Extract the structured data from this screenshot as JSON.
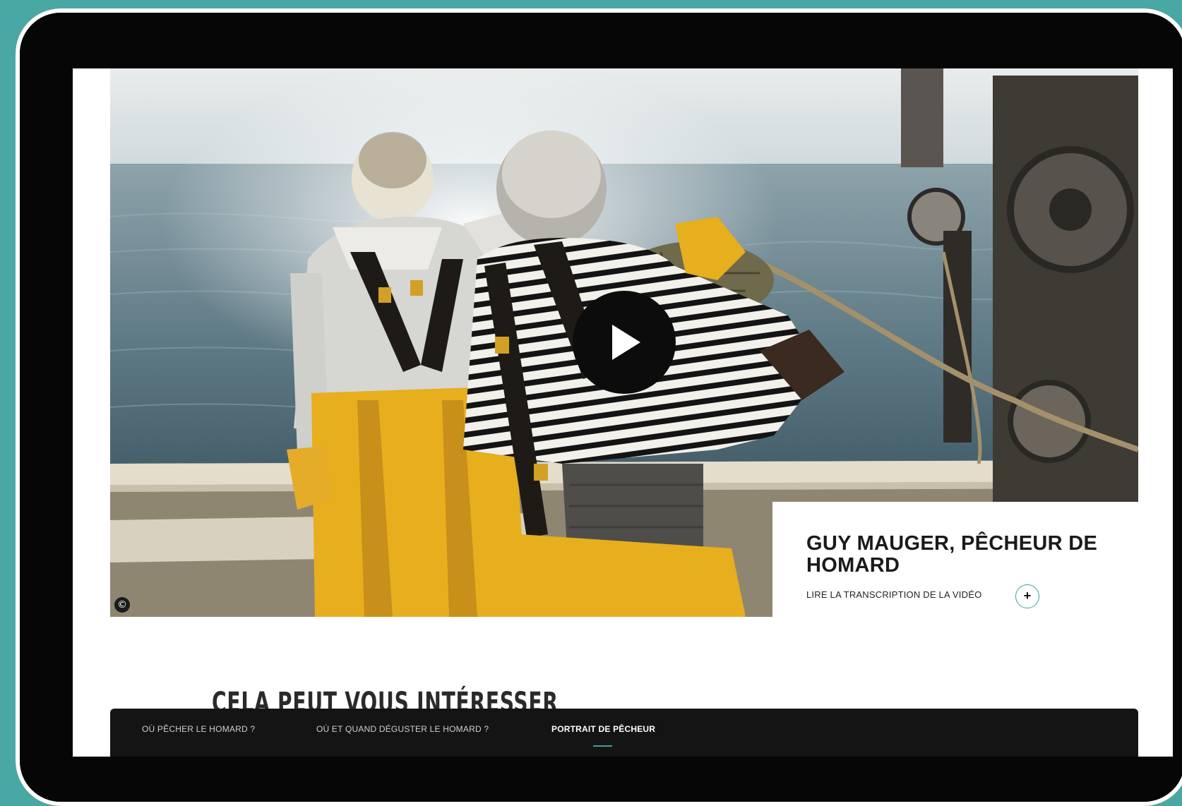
{
  "hero": {
    "copyright_symbol": "©",
    "play_label": "play"
  },
  "caption": {
    "title": "GUY MAUGER, PÊCHEUR DE HOMARD",
    "transcript_link": "LIRE LA TRANSCRIPTION DE LA VIDÉO",
    "expand_symbol": "+"
  },
  "section": {
    "heading": "CELA PEUT VOUS INTÉRESSER"
  },
  "bottom_nav": {
    "items": [
      {
        "label": "OÙ PÊCHER LE HOMARD ?",
        "active": false
      },
      {
        "label": "OÙ ET QUAND DÉGUSTER LE HOMARD ?",
        "active": false
      },
      {
        "label": "PORTRAIT DE PÊCHEUR",
        "active": true
      }
    ]
  },
  "colors": {
    "frame_background": "#4aa8a4",
    "accent": "#3aa39d",
    "nav_background": "#141414",
    "oilskin_yellow": "#e7ae1e"
  },
  "icons": [
    "play-icon",
    "plus-icon",
    "copyright-icon"
  ]
}
